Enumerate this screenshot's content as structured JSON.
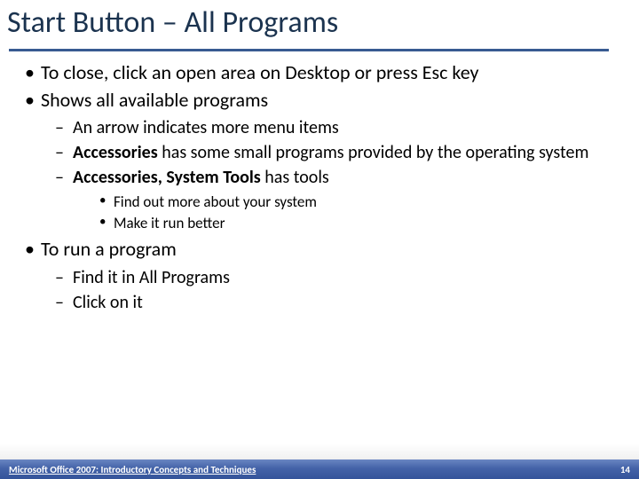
{
  "title": "Start Button – All Programs",
  "bullets": {
    "b1": "To close, click an open area on Desktop or press Esc key",
    "b2": "Shows all available programs",
    "b2_sub": {
      "s1": "An arrow indicates more menu items",
      "s2_bold": "Accessories",
      "s2_rest": " has some small programs provided by the operating system",
      "s3_bold": "Accessories, System Tools",
      "s3_rest": " has tools",
      "s3_sub": {
        "t1": "Find out more about your system",
        "t2": "Make it run better"
      }
    },
    "b3": "To run a program",
    "b3_sub": {
      "s1": "Find it in All Programs",
      "s2": "Click on it"
    }
  },
  "footer": {
    "left": "Microsoft Office 2007: Introductory Concepts and Techniques",
    "right": "14"
  }
}
